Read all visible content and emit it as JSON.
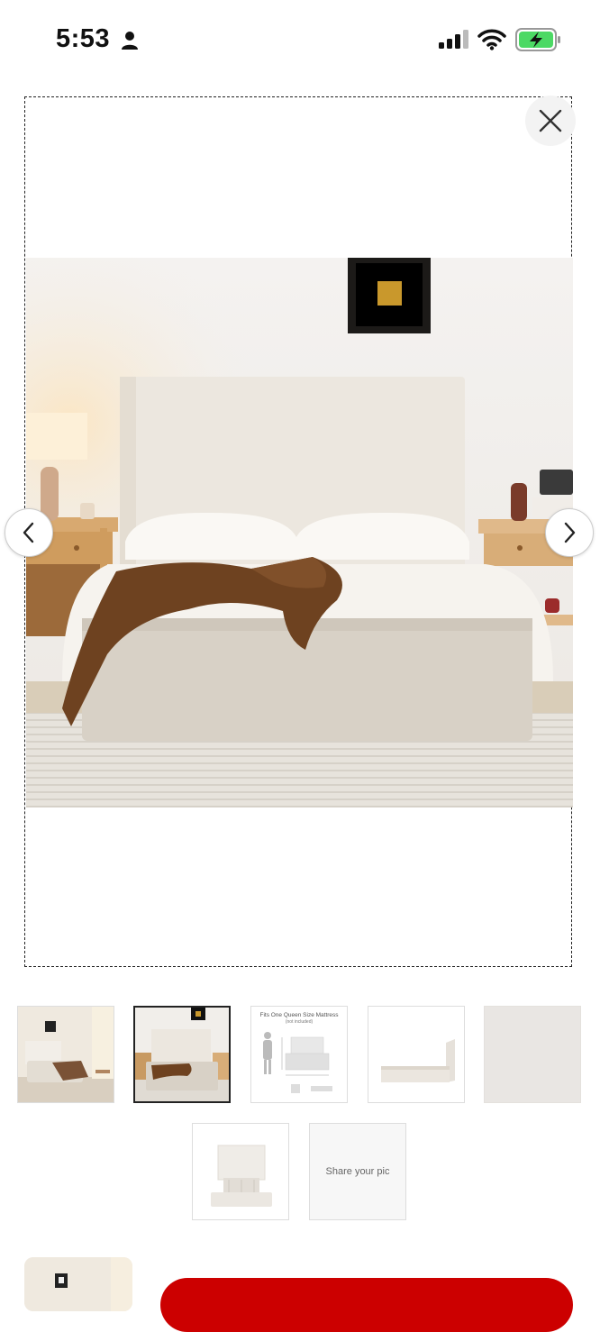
{
  "status_bar": {
    "time": "5:53",
    "icons": [
      "person-icon",
      "cellular-signal-icon",
      "wifi-icon",
      "battery-charging-icon"
    ],
    "battery_color": "#4cd964"
  },
  "viewer": {
    "close_icon": "close-icon",
    "prev_icon": "chevron-left-icon",
    "next_icon": "chevron-right-icon",
    "main_image": "bed-bedroom-photo"
  },
  "thumbnails": [
    {
      "kind": "bedroom-photo-wide",
      "selected": false
    },
    {
      "kind": "bedroom-photo-front",
      "selected": true
    },
    {
      "kind": "dimension-diagram",
      "selected": false,
      "caption": "Fits One Queen Size Mattress",
      "subcaption": "(not included)"
    },
    {
      "kind": "bed-side-view",
      "selected": false
    },
    {
      "kind": "fabric-swatch",
      "selected": false
    },
    {
      "kind": "bed-top-view",
      "selected": false
    },
    {
      "kind": "share-your-pic",
      "selected": false,
      "label": "Share your pic"
    }
  ],
  "colors": {
    "accent_red": "#cc0000",
    "selected_border": "#222222"
  }
}
